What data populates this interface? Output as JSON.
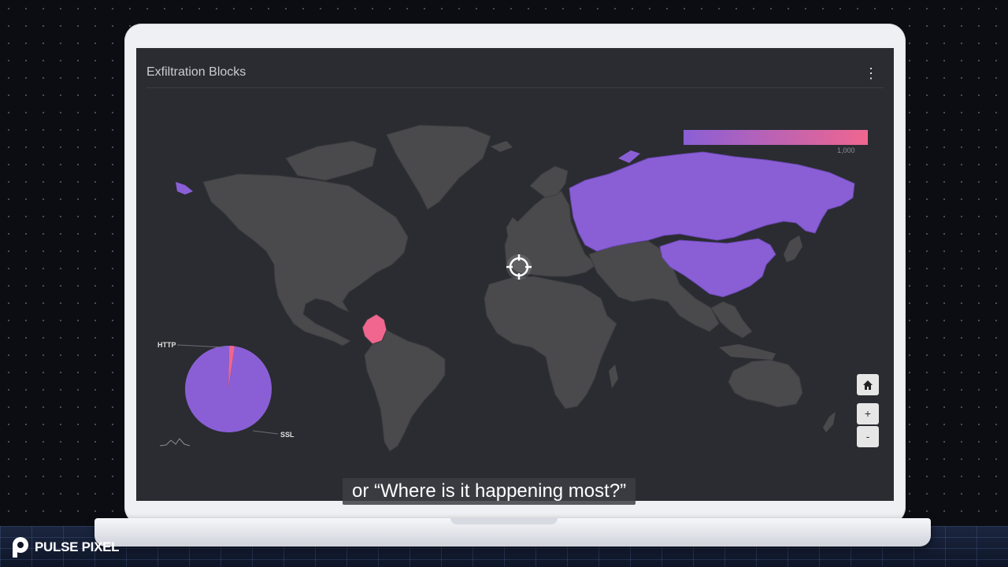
{
  "panel": {
    "title": "Exfiltration Blocks",
    "menu_icon": "kebab-menu-icon"
  },
  "legend": {
    "max_label": "1,000",
    "colors": [
      "#8a5fd6",
      "#f0668f"
    ]
  },
  "map": {
    "highlighted_countries": [
      {
        "name": "Russia",
        "color": "#8a5fd6"
      },
      {
        "name": "China",
        "color": "#8a5fd6"
      },
      {
        "name": "Colombia",
        "color": "#f0668f"
      }
    ],
    "controls": {
      "home_icon": "home-icon",
      "zoom_in": "+",
      "zoom_out": "-"
    }
  },
  "pie": {
    "http_label": "HTTP",
    "ssl_label": "SSL"
  },
  "caption": "or “Where is it happening most?”",
  "brand": {
    "name": "PULSE PIXEL"
  },
  "chart_data": {
    "type": "pie",
    "slices": [
      {
        "name": "HTTP",
        "share": 0.02,
        "color": "#f0668f"
      },
      {
        "name": "SSL",
        "share": 0.98,
        "color": "#8a5fd6"
      }
    ]
  }
}
